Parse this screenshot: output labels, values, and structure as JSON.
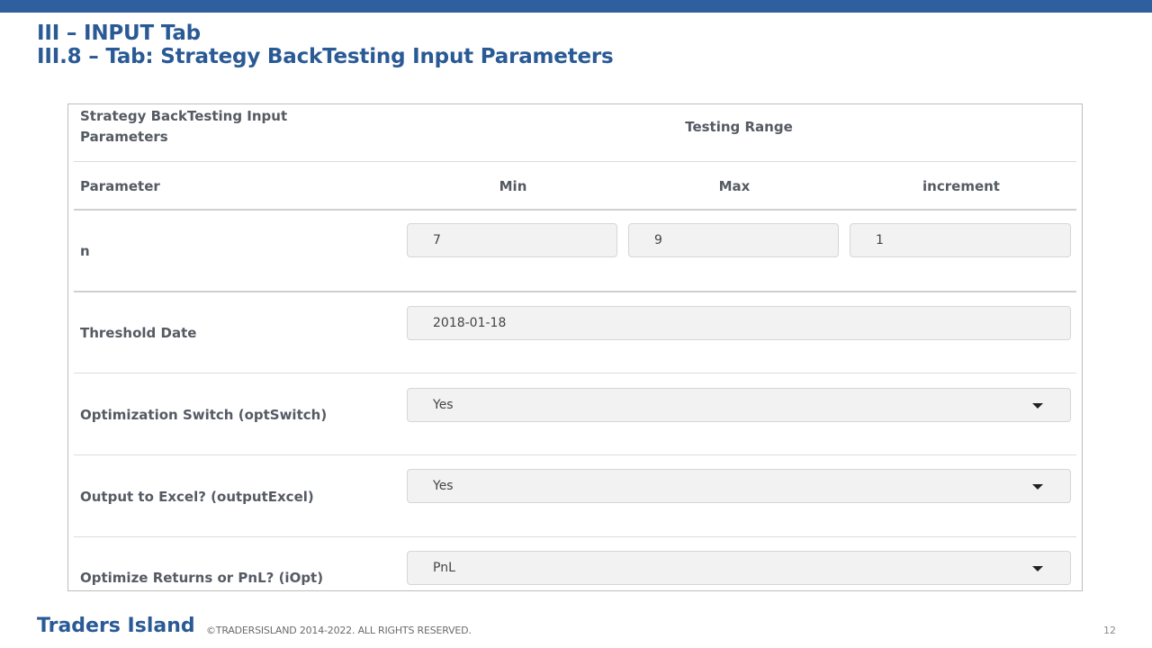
{
  "slide": {
    "title_line1": "III – INPUT Tab",
    "title_line2": "III.8 – Tab: Strategy BackTesting Input Parameters",
    "brand": "Traders Island",
    "copyright": "©TRADERSISLAND 2014-2022. ALL RIGHTS RESERVED.",
    "page_number": "12",
    "accent_color": "#2f5f9e"
  },
  "form": {
    "header_title": "Strategy BackTesting Input Parameters",
    "header_range": "Testing Range",
    "col_parameter": "Parameter",
    "col_min": "Min",
    "col_max": "Max",
    "col_increment": "increment",
    "rows": [
      {
        "label": "n",
        "min": "7",
        "max": "9",
        "increment": "1"
      },
      {
        "label": "Threshold Date",
        "value": "2018-01-18"
      },
      {
        "label": "Optimization Switch (optSwitch)",
        "value": "Yes"
      },
      {
        "label": "Output to Excel? (outputExcel)",
        "value": "Yes"
      },
      {
        "label": "Optimize Returns or PnL? (iOpt)",
        "value": "PnL"
      }
    ]
  }
}
